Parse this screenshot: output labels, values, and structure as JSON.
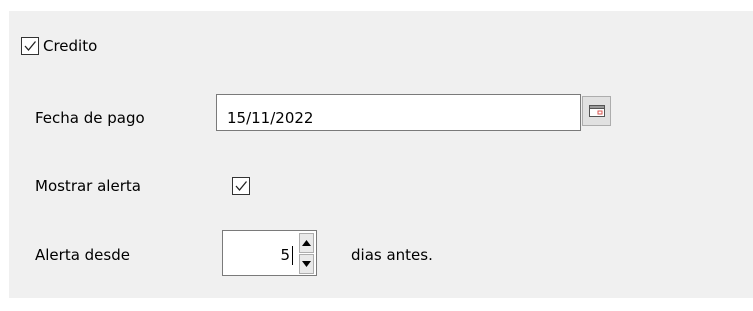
{
  "credito": {
    "label": "Credito",
    "checked": true
  },
  "fecha_pago": {
    "label": "Fecha de pago",
    "value": "15/11/2022",
    "button_icon": "calendar-icon"
  },
  "mostrar_alerta": {
    "label": "Mostrar alerta",
    "checked": true
  },
  "alerta_desde": {
    "label": "Alerta desde",
    "value": "5",
    "suffix": "dias antes."
  },
  "colors": {
    "panel": "#f0f0f0",
    "border": "#7a7a7a",
    "calendar_accent": "#d9534f"
  }
}
